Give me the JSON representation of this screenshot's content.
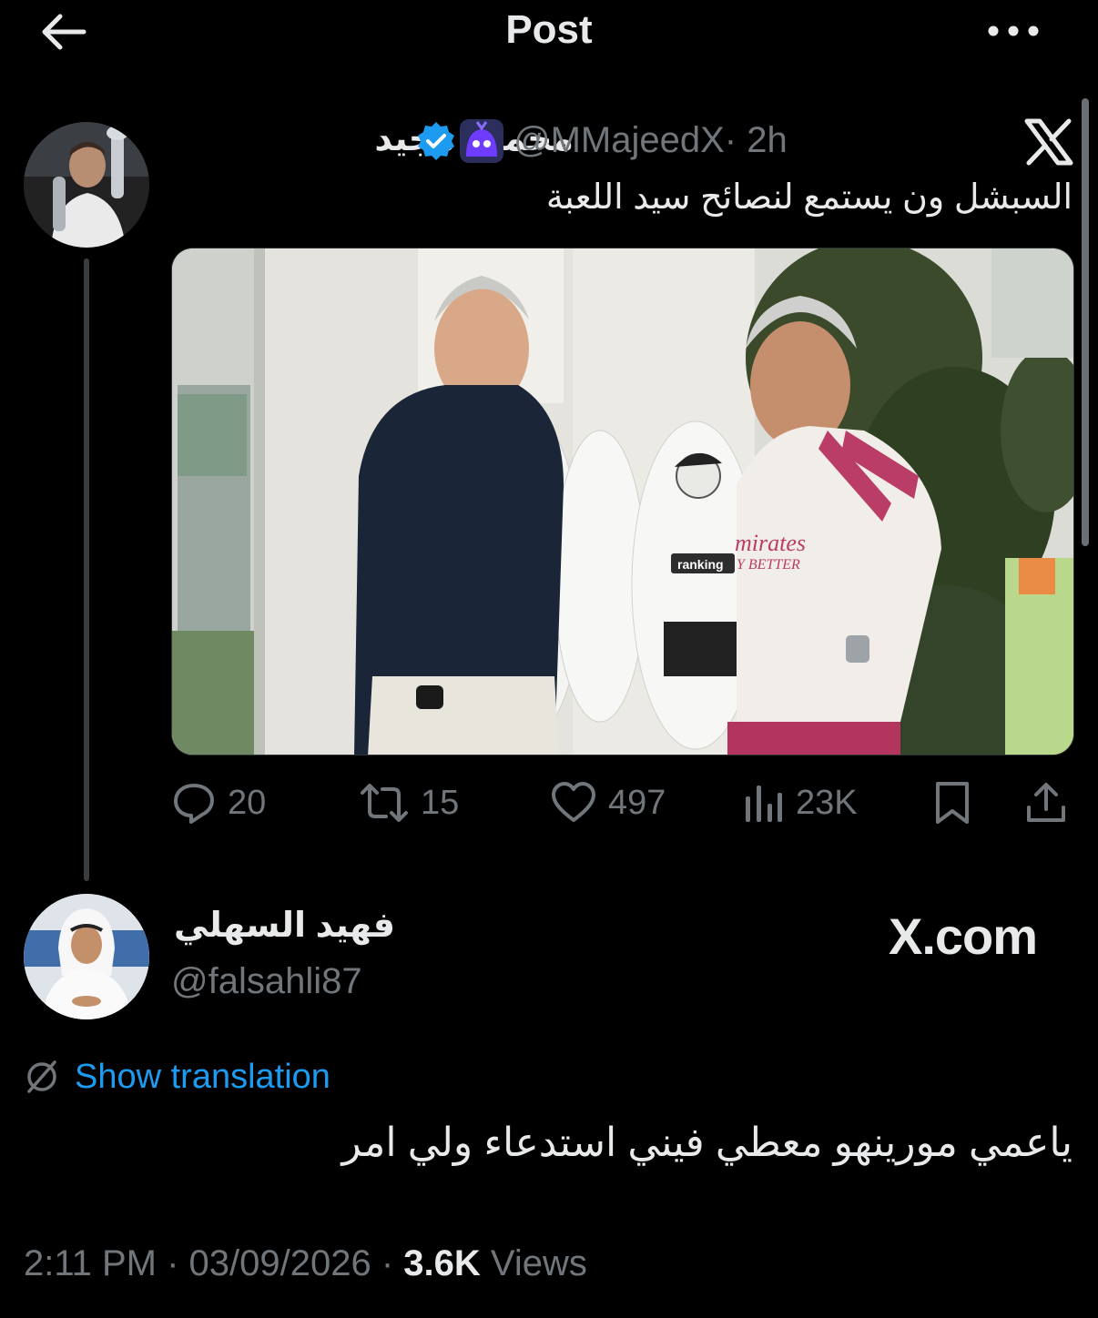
{
  "header": {
    "title": "Post",
    "back_icon": "arrow-left-icon",
    "more_icon": "more-horizontal-icon"
  },
  "quoted": {
    "name": "محمود مجيد",
    "handle": "@MMajeedX",
    "time": "· 2h",
    "text": "السبشل ون يستمع لنصائح سيد اللعبة",
    "stats": {
      "replies": "20",
      "reposts": "15",
      "likes": "497",
      "views": "23K"
    },
    "photo_text": {
      "left_dummy": "ranking",
      "shirt": "mirates",
      "shirt_sub": "Y BETTER"
    }
  },
  "reply": {
    "name": "فهيد السهلي",
    "handle": "@falsahli87",
    "watermark": "X.com",
    "translate_label": "Show translation",
    "text": "ياعمي مورينهو معطي فيني استدعاء ولي امر"
  },
  "meta": {
    "datetime": "2:11 PM · 03/09/2026 · ",
    "views_count": "3.6K",
    "views_label": " Views"
  },
  "colors": {
    "background": "#000000",
    "text": "#e7e9ea",
    "muted": "#71767b",
    "link": "#1d9bf0",
    "verified": "#1d9bf0"
  }
}
